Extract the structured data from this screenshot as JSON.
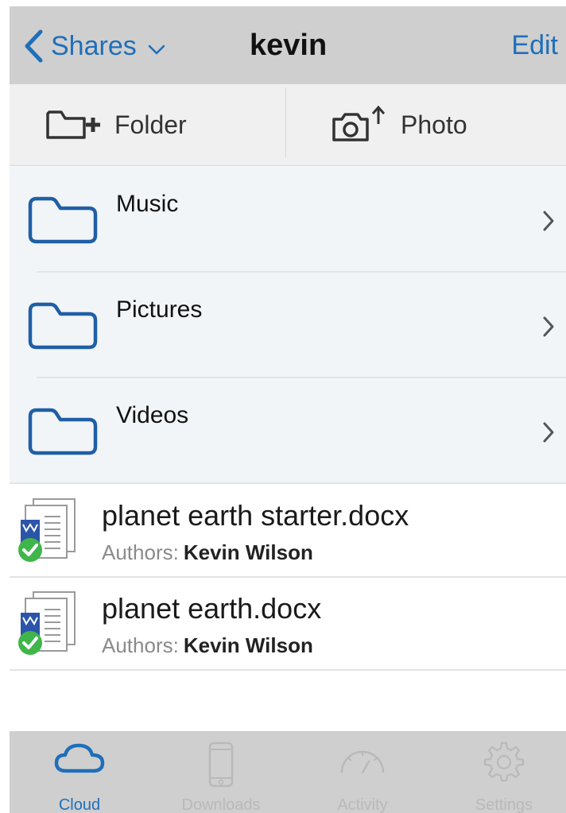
{
  "navbar": {
    "back_label": "Shares",
    "title": "kevin",
    "edit_label": "Edit"
  },
  "toolbar": {
    "folder_label": "Folder",
    "photo_label": "Photo"
  },
  "folders": [
    {
      "name": "Music"
    },
    {
      "name": "Pictures"
    },
    {
      "name": "Videos"
    }
  ],
  "files": [
    {
      "name": "planet earth starter.docx",
      "authors_label": "Authors:",
      "authors": "Kevin Wilson"
    },
    {
      "name": "planet earth.docx",
      "authors_label": "Authors:",
      "authors": "Kevin Wilson"
    }
  ],
  "tabs": [
    {
      "label": "Cloud",
      "icon": "cloud-icon",
      "active": true
    },
    {
      "label": "Downloads",
      "icon": "phone-icon",
      "active": false
    },
    {
      "label": "Activity",
      "icon": "gauge-icon",
      "active": false
    },
    {
      "label": "Settings",
      "icon": "gear-icon",
      "active": false
    }
  ],
  "colors": {
    "accent": "#1f6fb9",
    "bar_background": "#cfcfcf",
    "inactive_tab": "#b9b9b9",
    "check_green": "#3fb54a"
  }
}
